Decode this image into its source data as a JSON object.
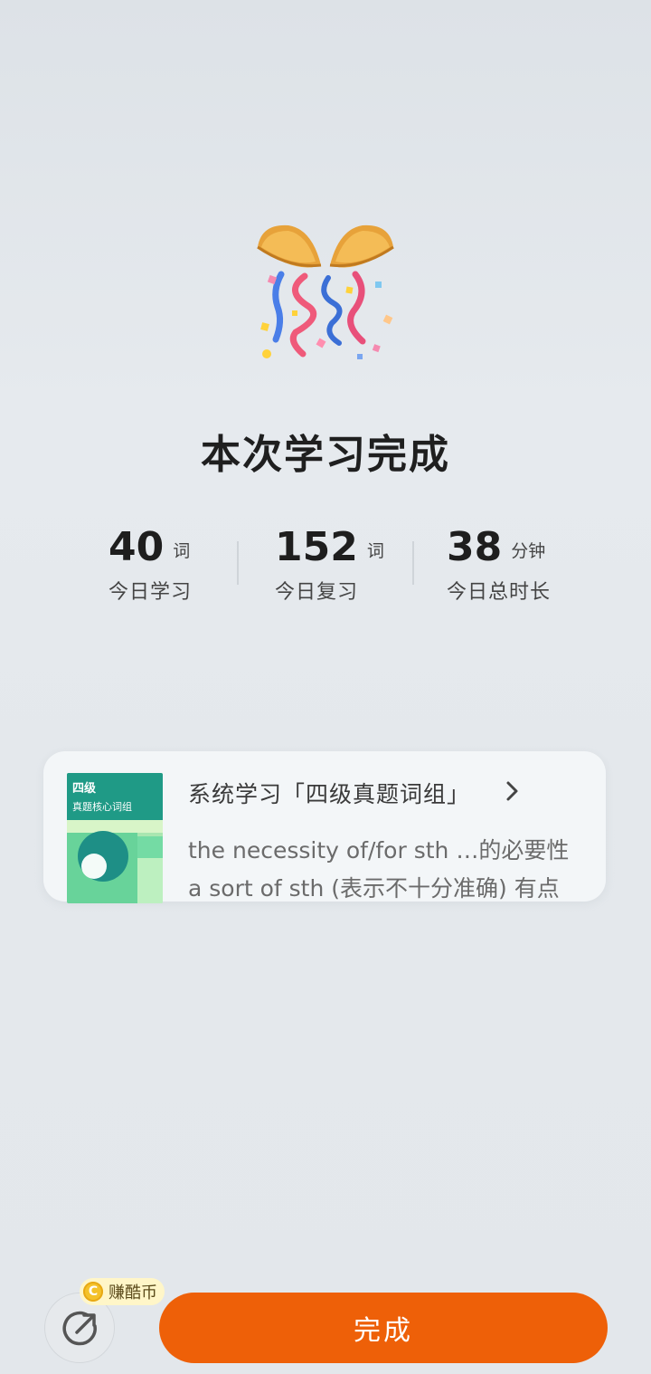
{
  "completion": {
    "title": "本次学习完成"
  },
  "stats": [
    {
      "value": "40",
      "unit": "词",
      "label": "今日学习"
    },
    {
      "value": "152",
      "unit": "词",
      "label": "今日复习"
    },
    {
      "value": "38",
      "unit": "分钟",
      "label": "今日总时长"
    }
  ],
  "card": {
    "cover_title": "四级",
    "cover_subtitle": "真题核心词组",
    "title": "系统学习「四级真题词组」",
    "lines": [
      "the necessity of/for sth …的必要性",
      "a sort of sth (表示不十分准确) 有点"
    ]
  },
  "bottom": {
    "coin_badge": "赚酷币",
    "coin_symbol": "C",
    "done_label": "完成"
  },
  "colors": {
    "accent": "#ee6008",
    "cover_green": "#1f9a86",
    "coin": "#f4c22a"
  },
  "icons": {
    "celebration": "party-popper-icon",
    "chevron": "chevron-right-icon",
    "share": "share-arrow-icon"
  }
}
